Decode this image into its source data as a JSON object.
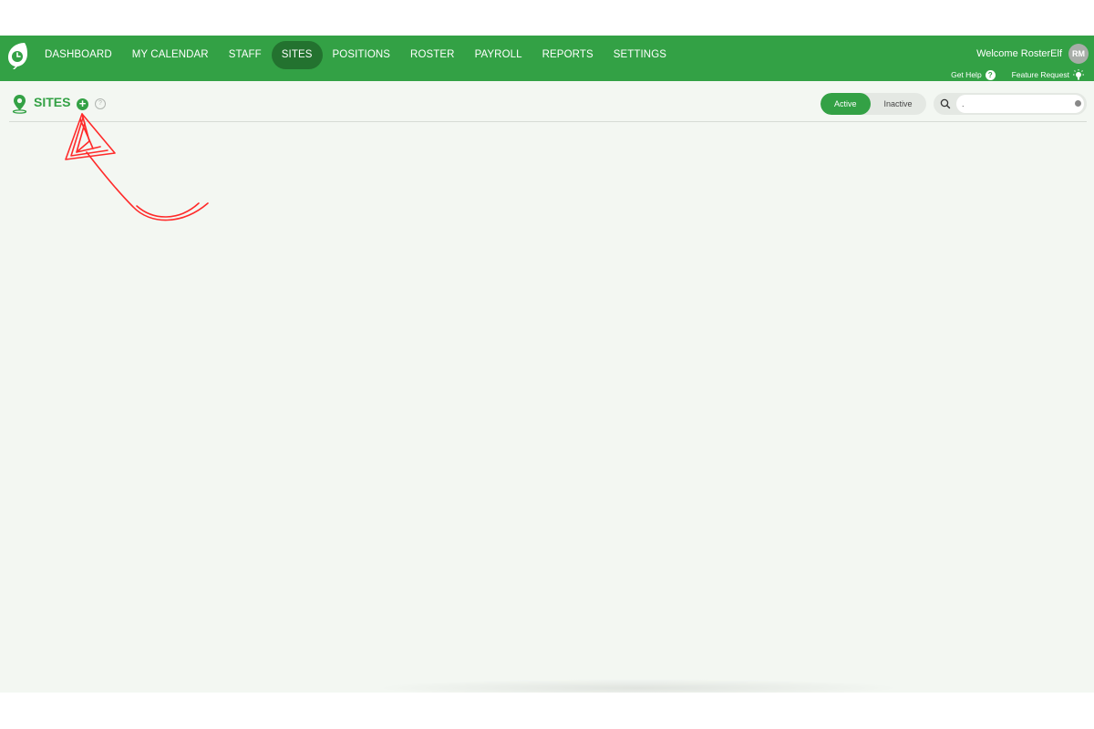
{
  "app": {
    "brand_color": "#33a145",
    "active_nav_color": "#23722f",
    "background_color": "#f3f7f2"
  },
  "nav": {
    "items": [
      {
        "label": "DASHBOARD"
      },
      {
        "label": "MY CALENDAR"
      },
      {
        "label": "STAFF"
      },
      {
        "label": "SITES"
      },
      {
        "label": "POSITIONS"
      },
      {
        "label": "ROSTER"
      },
      {
        "label": "PAYROLL"
      },
      {
        "label": "REPORTS"
      },
      {
        "label": "SETTINGS"
      }
    ],
    "active_label": "SITES"
  },
  "user": {
    "welcome_text": "Welcome RosterElf",
    "avatar_initials": "RM"
  },
  "sublinks": {
    "get_help": "Get Help",
    "feature_request": "Feature Request"
  },
  "page": {
    "title": "SITES",
    "icons": [
      "map-pin-icon",
      "add-icon",
      "help-icon"
    ]
  },
  "filter": {
    "active_label": "Active",
    "inactive_label": "Inactive",
    "selected": "Active"
  },
  "search": {
    "value": "."
  },
  "annotation": {
    "type": "red-hand-drawn-arrow",
    "color": "#ff2a2a",
    "target": "add-site-button"
  }
}
